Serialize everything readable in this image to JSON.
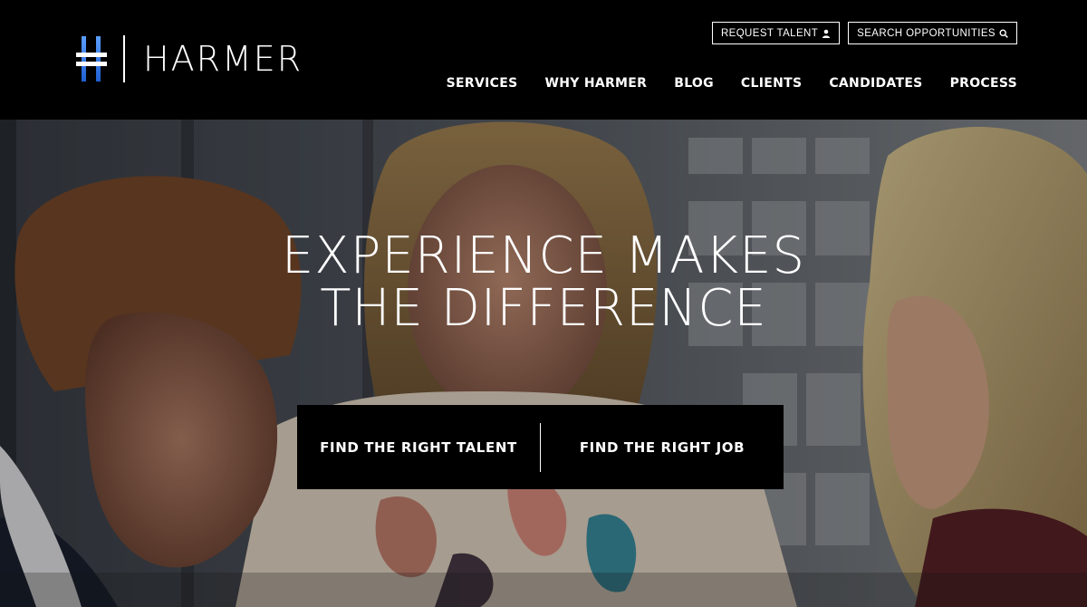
{
  "brand": {
    "name": "HARMER",
    "accent": "#3a7bd5"
  },
  "utility": {
    "request_talent": "REQUEST TALENT",
    "search_opportunities": "SEARCH OPPORTUNITIES"
  },
  "nav": {
    "items": [
      {
        "label": "SERVICES"
      },
      {
        "label": "WHY HARMER"
      },
      {
        "label": "BLOG"
      },
      {
        "label": "CLIENTS"
      },
      {
        "label": "CANDIDATES"
      },
      {
        "label": "PROCESS"
      }
    ]
  },
  "hero": {
    "headline_line1": "EXPERIENCE MAKES",
    "headline_line2": "THE DIFFERENCE",
    "cta_talent": "FIND THE RIGHT TALENT",
    "cta_job": "FIND THE RIGHT JOB"
  },
  "icons": {
    "request_talent": "user-icon",
    "search_opportunities": "search-icon"
  }
}
